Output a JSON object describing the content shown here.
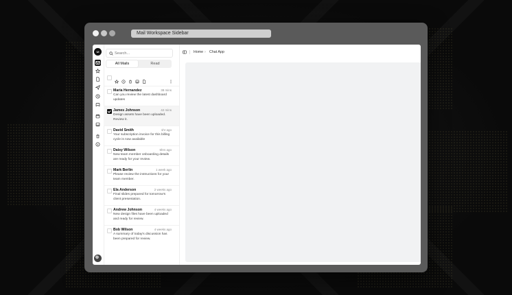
{
  "window": {
    "address": "Mail Workspace Sidebar"
  },
  "rail": {
    "logo": "UI",
    "icons": [
      "mail-icon",
      "star-icon",
      "file-icon",
      "send-icon",
      "clock-icon",
      "archive-icon",
      "calendar-icon",
      "inbox-icon",
      "trash-icon",
      "info-icon"
    ]
  },
  "search": {
    "placeholder": "Search..."
  },
  "tabs": [
    {
      "label": "All Mails"
    },
    {
      "label": "Read"
    }
  ],
  "breadcrumb": {
    "home": "Home",
    "separator": "›",
    "current": "Chat App"
  },
  "mails": [
    {
      "name": "Maria Hernandez",
      "time": "38 mins",
      "preview": "Can you review the latest dashboard updates",
      "checked": false
    },
    {
      "name": "James Johnson",
      "time": "42 mins",
      "preview": "Design assets have been uploaded. Review it.",
      "checked": true
    },
    {
      "name": "David Smith",
      "time": "1hr ago",
      "preview": "Your subscription invoice for this billing cycle is now available",
      "checked": false
    },
    {
      "name": "Daisy Wilson",
      "time": "5hrs ago",
      "preview": "New team member onboarding details are ready for your review.",
      "checked": false
    },
    {
      "name": "Mark Berlin",
      "time": "1 week ago",
      "preview": "Please review the instructions for your team member.",
      "checked": false
    },
    {
      "name": "Ela Anderson",
      "time": "2 weeks ago",
      "preview": "Final slides prepared for tomorrow's client presentation.",
      "checked": false
    },
    {
      "name": "Andrew Johnson",
      "time": "4 weeks ago",
      "preview": "New design files have been uploaded and ready for review.",
      "checked": false
    },
    {
      "name": "Bob Wilson",
      "time": "4 weeks ago",
      "preview": "A summary of today's discussion has been prepared for review.",
      "checked": false
    }
  ],
  "colors": {
    "accent": "#111111",
    "content_bg": "#f1f2f3",
    "window_frame": "#5a5a5a"
  }
}
